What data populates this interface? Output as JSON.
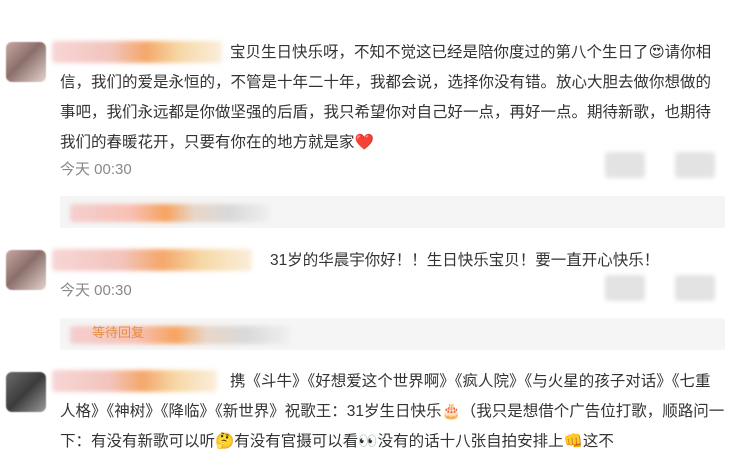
{
  "comments": [
    {
      "text": "宝贝生日快乐呀，不知不觉这已经是陪你度过的第八个生日了😍请你相信，我们的爱是永恒的，不管是十年二十年，我都会说，选择你没有错。放心大胆去做你想做的事吧，我们永远都是你做坚强的后盾，我只希望你对自己好一点，再好一点。期待新歌，也期待我们的春暖花开，只要有你在的地方就是家❤️",
      "time": "今天 00:30"
    },
    {
      "text": "31岁的华晨宇你好！！生日快乐宝贝！要一直开心快乐！",
      "time": "今天 00:30",
      "reply_label": "等待回复"
    },
    {
      "text": "携《斗牛》《好想爱这个世界啊》《疯人院》《与火星的孩子对话》《七重人格》《神树》《降临》《新世界》祝歌王：31岁生日快乐🎂（我只是想借个广告位打歌，顺路问一下：有没有新歌可以听🤔有没有官摄可以看👀没有的话十八张自拍安排上👊这不"
    }
  ],
  "colors": {
    "text": "#333333",
    "time": "#888888",
    "reply_bg": "#f5f5f5"
  }
}
